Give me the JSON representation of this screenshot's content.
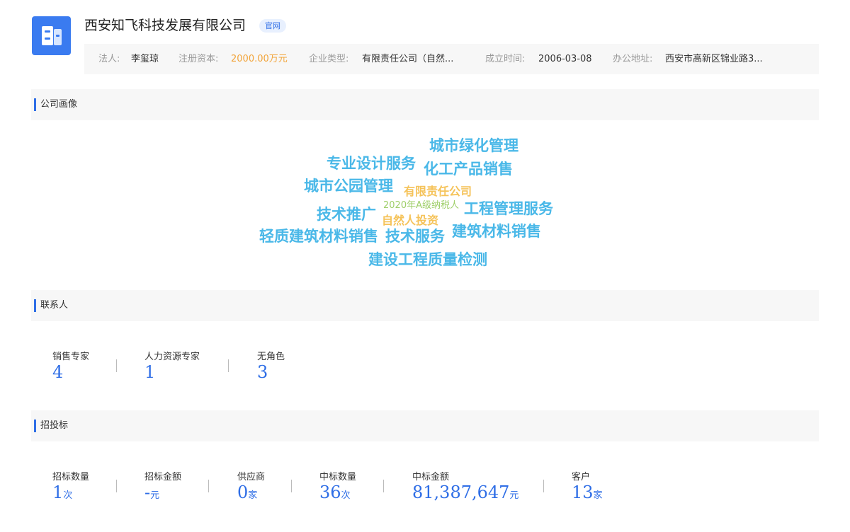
{
  "company": {
    "name": "西安知飞科技发展有限公司",
    "official_tag": "官网"
  },
  "info": {
    "legal_label": "法人:",
    "legal_value": "李玺琼",
    "capital_label": "注册资本:",
    "capital_value": "2000.00万元",
    "type_label": "企业类型:",
    "type_value": "有限责任公司（自然...",
    "founded_label": "成立时间:",
    "founded_value": "2006-03-08",
    "address_label": "办公地址:",
    "address_value": "西安市高新区锦业路3..."
  },
  "sections": {
    "portrait": "公司画像",
    "contacts": "联系人",
    "bidding": "招投标"
  },
  "word_cloud": [
    {
      "text": "城市绿化管理",
      "color": "#4ab8e8"
    },
    {
      "text": "专业设计服务",
      "color": "#4ab8e8"
    },
    {
      "text": "化工产品销售",
      "color": "#4ab8e8"
    },
    {
      "text": "城市公园管理",
      "color": "#4ab8e8"
    },
    {
      "text": "有限责任公司",
      "color": "#f5c35a"
    },
    {
      "text": "技术推广",
      "color": "#4ab8e8"
    },
    {
      "text": "2020年A级纳税人",
      "color": "#9fcf6a"
    },
    {
      "text": "工程管理服务",
      "color": "#4ab8e8"
    },
    {
      "text": "自然人投资",
      "color": "#f5c35a"
    },
    {
      "text": "轻质建筑材料销售",
      "color": "#4ab8e8"
    },
    {
      "text": "技术服务",
      "color": "#4ab8e8"
    },
    {
      "text": "建筑材料销售",
      "color": "#4ab8e8"
    },
    {
      "text": "建设工程质量检测",
      "color": "#4ab8e8"
    }
  ],
  "contacts": [
    {
      "label": "销售专家",
      "value": "4"
    },
    {
      "label": "人力资源专家",
      "value": "1"
    },
    {
      "label": "无角色",
      "value": "3"
    }
  ],
  "bidding": [
    {
      "label": "招标数量",
      "value": "1",
      "unit": "次"
    },
    {
      "label": "招标金额",
      "value": "-",
      "unit": "元"
    },
    {
      "label": "供应商",
      "value": "0",
      "unit": "家"
    },
    {
      "label": "中标数量",
      "value": "36",
      "unit": "次"
    },
    {
      "label": "中标金额",
      "value": "81,387,647",
      "unit": "元"
    },
    {
      "label": "客户",
      "value": "13",
      "unit": "家"
    }
  ],
  "colors": {
    "accent": "#2f6ee6",
    "capital": "#f2a43a",
    "cloud_blue": "#4ab8e8",
    "cloud_yellow": "#f5c35a",
    "cloud_green": "#9fcf6a"
  }
}
